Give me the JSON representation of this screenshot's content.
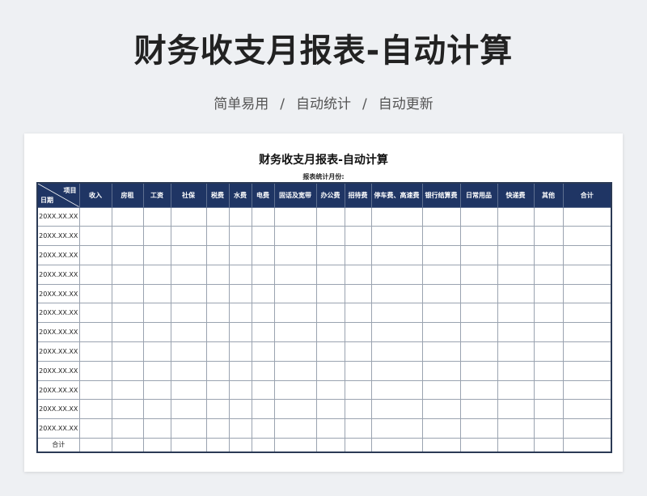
{
  "header": {
    "title": "财务收支月报表-自动计算",
    "subtitle_items": [
      "简单易用",
      "自动统计",
      "自动更新"
    ],
    "separator": "/"
  },
  "sheet": {
    "title": "财务收支月报表-自动计算",
    "month_label": "报表统计月份:",
    "corner_top": "项目",
    "corner_bottom": "日期",
    "columns": [
      "收入",
      "房租",
      "工资",
      "社保",
      "税费",
      "水费",
      "电费",
      "固话及宽带",
      "办公费",
      "招待费",
      "停车费、高速费",
      "银行结算费",
      "日常用品",
      "快递费",
      "其他",
      "合计"
    ],
    "row_dates": [
      "20XX.XX.XX",
      "20XX.XX.XX",
      "20XX.XX.XX",
      "20XX.XX.XX",
      "20XX.XX.XX",
      "20XX.XX.XX",
      "20XX.XX.XX",
      "20XX.XX.XX",
      "20XX.XX.XX",
      "20XX.XX.XX",
      "20XX.XX.XX",
      "20XX.XX.XX"
    ],
    "total_label": "合计"
  },
  "colors": {
    "header_bg": "#1f3564",
    "page_bg": "#eef0f3"
  }
}
